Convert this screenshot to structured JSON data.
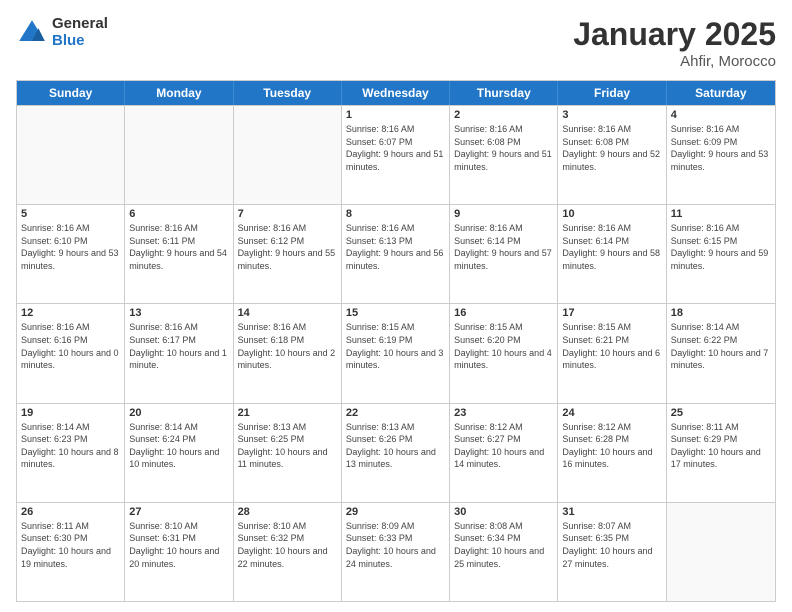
{
  "logo": {
    "general": "General",
    "blue": "Blue"
  },
  "title": "January 2025",
  "subtitle": "Ahfir, Morocco",
  "header_days": [
    "Sunday",
    "Monday",
    "Tuesday",
    "Wednesday",
    "Thursday",
    "Friday",
    "Saturday"
  ],
  "weeks": [
    [
      {
        "day": "",
        "info": "",
        "empty": true
      },
      {
        "day": "",
        "info": "",
        "empty": true
      },
      {
        "day": "",
        "info": "",
        "empty": true
      },
      {
        "day": "1",
        "info": "Sunrise: 8:16 AM\nSunset: 6:07 PM\nDaylight: 9 hours\nand 51 minutes.",
        "empty": false
      },
      {
        "day": "2",
        "info": "Sunrise: 8:16 AM\nSunset: 6:08 PM\nDaylight: 9 hours\nand 51 minutes.",
        "empty": false
      },
      {
        "day": "3",
        "info": "Sunrise: 8:16 AM\nSunset: 6:08 PM\nDaylight: 9 hours\nand 52 minutes.",
        "empty": false
      },
      {
        "day": "4",
        "info": "Sunrise: 8:16 AM\nSunset: 6:09 PM\nDaylight: 9 hours\nand 53 minutes.",
        "empty": false
      }
    ],
    [
      {
        "day": "5",
        "info": "Sunrise: 8:16 AM\nSunset: 6:10 PM\nDaylight: 9 hours\nand 53 minutes.",
        "empty": false
      },
      {
        "day": "6",
        "info": "Sunrise: 8:16 AM\nSunset: 6:11 PM\nDaylight: 9 hours\nand 54 minutes.",
        "empty": false
      },
      {
        "day": "7",
        "info": "Sunrise: 8:16 AM\nSunset: 6:12 PM\nDaylight: 9 hours\nand 55 minutes.",
        "empty": false
      },
      {
        "day": "8",
        "info": "Sunrise: 8:16 AM\nSunset: 6:13 PM\nDaylight: 9 hours\nand 56 minutes.",
        "empty": false
      },
      {
        "day": "9",
        "info": "Sunrise: 8:16 AM\nSunset: 6:14 PM\nDaylight: 9 hours\nand 57 minutes.",
        "empty": false
      },
      {
        "day": "10",
        "info": "Sunrise: 8:16 AM\nSunset: 6:14 PM\nDaylight: 9 hours\nand 58 minutes.",
        "empty": false
      },
      {
        "day": "11",
        "info": "Sunrise: 8:16 AM\nSunset: 6:15 PM\nDaylight: 9 hours\nand 59 minutes.",
        "empty": false
      }
    ],
    [
      {
        "day": "12",
        "info": "Sunrise: 8:16 AM\nSunset: 6:16 PM\nDaylight: 10 hours\nand 0 minutes.",
        "empty": false
      },
      {
        "day": "13",
        "info": "Sunrise: 8:16 AM\nSunset: 6:17 PM\nDaylight: 10 hours\nand 1 minute.",
        "empty": false
      },
      {
        "day": "14",
        "info": "Sunrise: 8:16 AM\nSunset: 6:18 PM\nDaylight: 10 hours\nand 2 minutes.",
        "empty": false
      },
      {
        "day": "15",
        "info": "Sunrise: 8:15 AM\nSunset: 6:19 PM\nDaylight: 10 hours\nand 3 minutes.",
        "empty": false
      },
      {
        "day": "16",
        "info": "Sunrise: 8:15 AM\nSunset: 6:20 PM\nDaylight: 10 hours\nand 4 minutes.",
        "empty": false
      },
      {
        "day": "17",
        "info": "Sunrise: 8:15 AM\nSunset: 6:21 PM\nDaylight: 10 hours\nand 6 minutes.",
        "empty": false
      },
      {
        "day": "18",
        "info": "Sunrise: 8:14 AM\nSunset: 6:22 PM\nDaylight: 10 hours\nand 7 minutes.",
        "empty": false
      }
    ],
    [
      {
        "day": "19",
        "info": "Sunrise: 8:14 AM\nSunset: 6:23 PM\nDaylight: 10 hours\nand 8 minutes.",
        "empty": false
      },
      {
        "day": "20",
        "info": "Sunrise: 8:14 AM\nSunset: 6:24 PM\nDaylight: 10 hours\nand 10 minutes.",
        "empty": false
      },
      {
        "day": "21",
        "info": "Sunrise: 8:13 AM\nSunset: 6:25 PM\nDaylight: 10 hours\nand 11 minutes.",
        "empty": false
      },
      {
        "day": "22",
        "info": "Sunrise: 8:13 AM\nSunset: 6:26 PM\nDaylight: 10 hours\nand 13 minutes.",
        "empty": false
      },
      {
        "day": "23",
        "info": "Sunrise: 8:12 AM\nSunset: 6:27 PM\nDaylight: 10 hours\nand 14 minutes.",
        "empty": false
      },
      {
        "day": "24",
        "info": "Sunrise: 8:12 AM\nSunset: 6:28 PM\nDaylight: 10 hours\nand 16 minutes.",
        "empty": false
      },
      {
        "day": "25",
        "info": "Sunrise: 8:11 AM\nSunset: 6:29 PM\nDaylight: 10 hours\nand 17 minutes.",
        "empty": false
      }
    ],
    [
      {
        "day": "26",
        "info": "Sunrise: 8:11 AM\nSunset: 6:30 PM\nDaylight: 10 hours\nand 19 minutes.",
        "empty": false
      },
      {
        "day": "27",
        "info": "Sunrise: 8:10 AM\nSunset: 6:31 PM\nDaylight: 10 hours\nand 20 minutes.",
        "empty": false
      },
      {
        "day": "28",
        "info": "Sunrise: 8:10 AM\nSunset: 6:32 PM\nDaylight: 10 hours\nand 22 minutes.",
        "empty": false
      },
      {
        "day": "29",
        "info": "Sunrise: 8:09 AM\nSunset: 6:33 PM\nDaylight: 10 hours\nand 24 minutes.",
        "empty": false
      },
      {
        "day": "30",
        "info": "Sunrise: 8:08 AM\nSunset: 6:34 PM\nDaylight: 10 hours\nand 25 minutes.",
        "empty": false
      },
      {
        "day": "31",
        "info": "Sunrise: 8:07 AM\nSunset: 6:35 PM\nDaylight: 10 hours\nand 27 minutes.",
        "empty": false
      },
      {
        "day": "",
        "info": "",
        "empty": true
      }
    ]
  ]
}
